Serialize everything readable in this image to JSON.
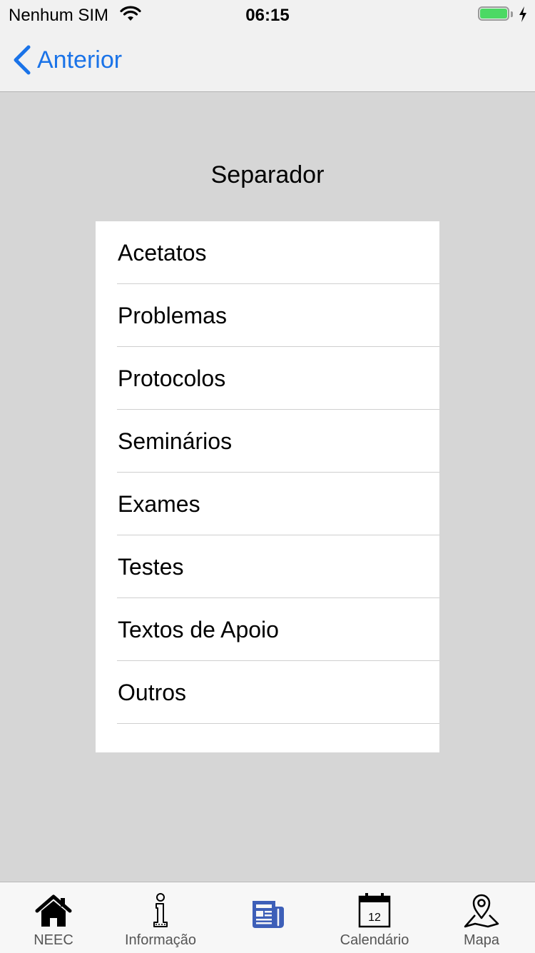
{
  "status_bar": {
    "carrier": "Nenhum SIM",
    "time": "06:15",
    "battery_level": 1.0
  },
  "nav": {
    "back_label": "Anterior"
  },
  "page": {
    "title": "Separador"
  },
  "list": {
    "items": [
      {
        "label": "Acetatos"
      },
      {
        "label": "Problemas"
      },
      {
        "label": "Protocolos"
      },
      {
        "label": "Seminários"
      },
      {
        "label": "Exames"
      },
      {
        "label": "Testes"
      },
      {
        "label": "Textos de Apoio"
      },
      {
        "label": "Outros"
      }
    ]
  },
  "tab_bar": {
    "tabs": [
      {
        "label": "NEEC",
        "icon": "home-icon"
      },
      {
        "label": "Informação",
        "icon": "info-icon"
      },
      {
        "label": "",
        "icon": "newspaper-icon",
        "selected": true
      },
      {
        "label": "Calendário",
        "icon": "calendar-icon",
        "calendar_day": "12"
      },
      {
        "label": "Mapa",
        "icon": "map-pin-icon"
      }
    ]
  },
  "colors": {
    "accent": "#1a73e8",
    "selected_tab": "#3d5fb8",
    "background": "#d6d6d6",
    "battery_fill": "#4cd964"
  }
}
